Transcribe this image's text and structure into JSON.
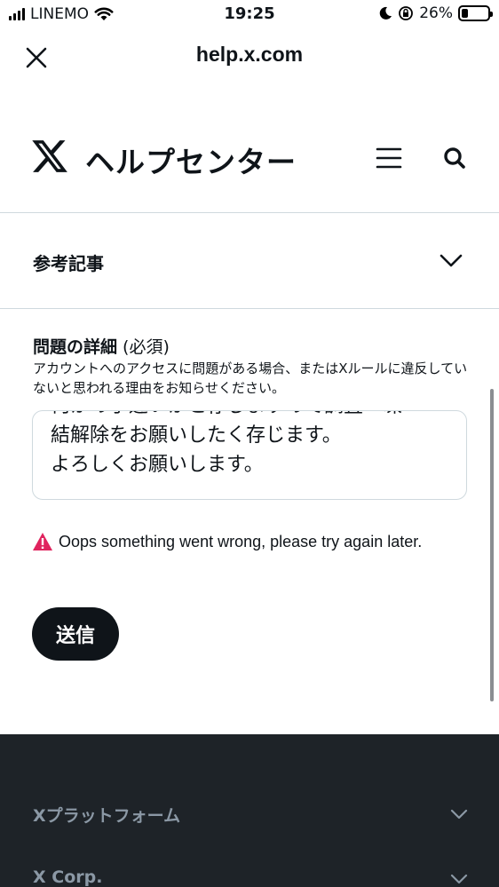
{
  "status_bar": {
    "carrier": "LINEMO",
    "time": "19:25",
    "battery": "26%",
    "battery_level": 0.26
  },
  "browser": {
    "domain": "help.x.com"
  },
  "header": {
    "title": "ヘルプセンター"
  },
  "accordion": {
    "label": "参考記事"
  },
  "form": {
    "field_label": "問題の詳細",
    "field_required": " (必須)",
    "field_description": "アカウントへのアクセスに問題がある場合、またはXルールに違反していないと思われる理由をお知らせください。",
    "textarea_lines": [
      "何かの手違いかと存じますので調査・凍",
      "結解除をお願いしたく存じます。",
      "よろしくお願いします。"
    ],
    "error_message": "Oops something went wrong, please try again later.",
    "submit_label": "送信"
  },
  "footer": {
    "items": [
      {
        "label": "Xプラットフォーム"
      },
      {
        "label": "X Corp."
      }
    ]
  },
  "colors": {
    "text": "#0f1419",
    "border": "#cfd9de",
    "error": "#e0245e",
    "footer_bg": "#1e2328",
    "footer_text": "#8b98a5"
  },
  "icons": [
    "signal-icon",
    "wifi-icon",
    "moon-icon",
    "orientation-lock-icon",
    "battery-icon",
    "close-icon",
    "x-logo-icon",
    "menu-icon",
    "search-icon",
    "chevron-down-icon",
    "warning-icon"
  ]
}
